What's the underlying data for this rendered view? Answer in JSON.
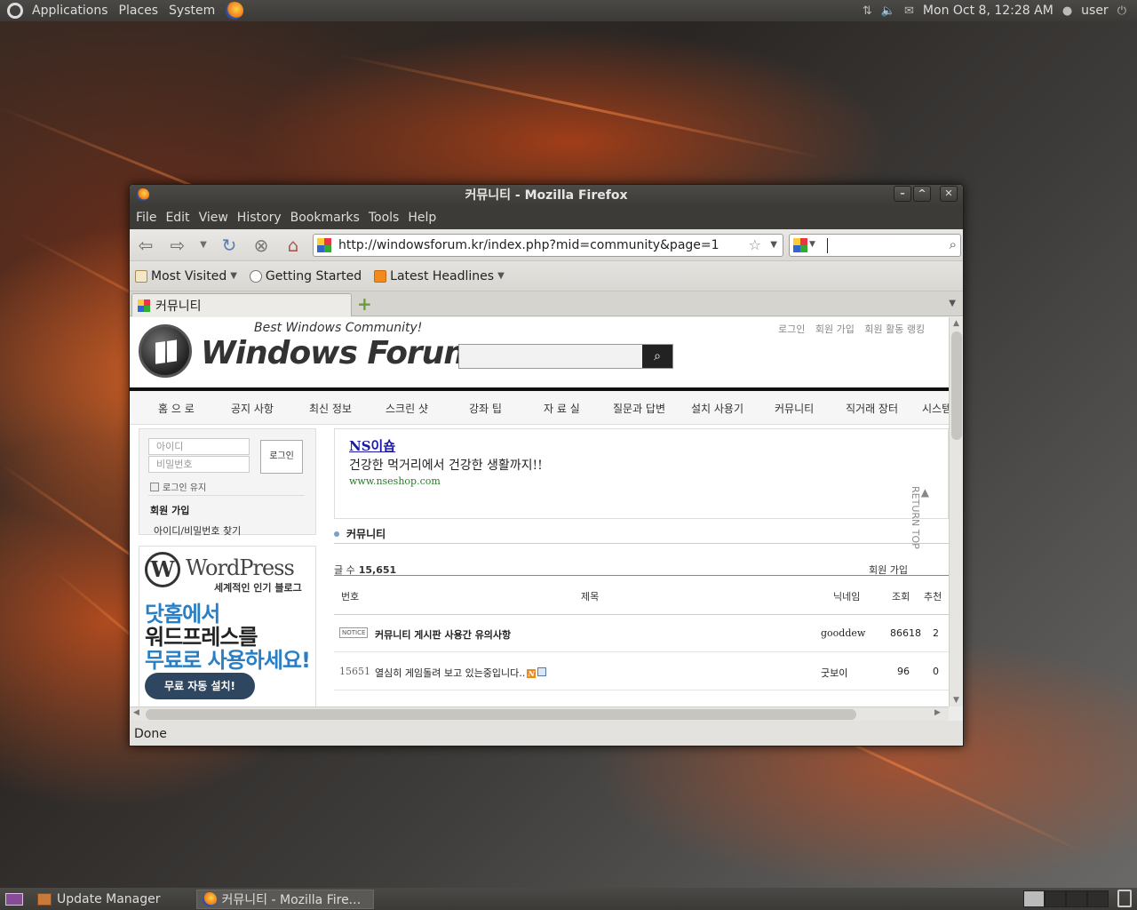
{
  "top_panel": {
    "menus": [
      "Applications",
      "Places",
      "System"
    ],
    "clock": "Mon Oct 8, 12:28 AM",
    "user": "user"
  },
  "bottom_panel": {
    "tasks": [
      "Update Manager",
      "커뮤니티 - Mozilla Fire..."
    ]
  },
  "window": {
    "title": "커뮤니티 - Mozilla Firefox",
    "menu": [
      "File",
      "Edit",
      "View",
      "History",
      "Bookmarks",
      "Tools",
      "Help"
    ],
    "url": "http://windowsforum.kr/index.php?mid=community&page=1",
    "bookmarks": [
      "Most Visited",
      "Getting Started",
      "Latest Headlines"
    ],
    "tab_title": "커뮤니티",
    "status": "Done"
  },
  "site": {
    "tagline": "Best Windows Community!",
    "logo": "Windows Forum",
    "top_links": [
      "로그인",
      "회원 가입",
      "회원 활동 랭킹"
    ],
    "nav": [
      "홈 으 로",
      "공지 사항",
      "최신 정보",
      "스크린 샷",
      "강좌 팁",
      "자 료 실",
      "질문과 답변",
      "설치 사용기",
      "커뮤니티",
      "직거래 장터",
      "시스템"
    ],
    "login": {
      "id_placeholder": "아이디",
      "pw_placeholder": "비밀번호",
      "button": "로그인",
      "remember": "로그인 유지",
      "join": "회원 가입",
      "find": "아이디/비밀번호 찾기"
    },
    "wp_ad": {
      "logo": "W",
      "name": "WordPress",
      "sub": "세계적인 인기 블로그",
      "line1": "닷홈에서",
      "line2": "워드프레스를",
      "line3": "무료로 사용하세요!",
      "cta": "무료 자동 설치!"
    },
    "ns_ad": {
      "title": "NS이숍",
      "desc": "건강한 먹거리에서 건강한 생활까지!!",
      "url": "www.nseshop.com"
    },
    "board": {
      "title": "커뮤니티",
      "count_label": "글 수",
      "count": "15,651",
      "right": "회원 가입",
      "return_top": "RETURN TOP",
      "headers": {
        "no": "번호",
        "subject": "제목",
        "nick": "닉네임",
        "views": "조회",
        "votes": "추천"
      },
      "rows": [
        {
          "no": "NOTICE",
          "subject": "커뮤니티 게시판 사용간 유의사항",
          "nick": "gooddew",
          "views": "86618",
          "votes": "2"
        },
        {
          "no": "15651",
          "subject": "열심히 게임돌려 보고 있는중입니다..",
          "nick": "굿보이",
          "views": "96",
          "votes": "0"
        }
      ]
    }
  }
}
